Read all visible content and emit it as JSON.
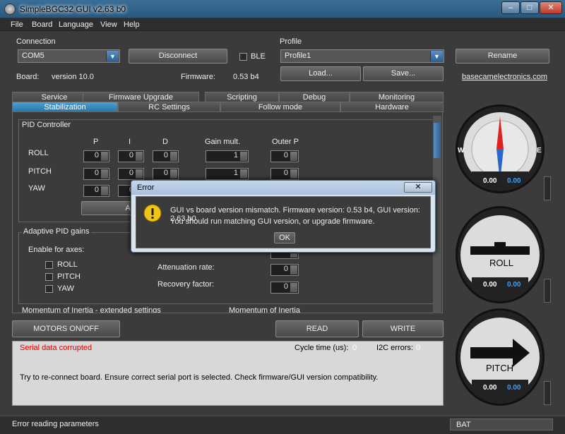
{
  "window": {
    "title": "SimpleBGC32 GUI v2.63 b0",
    "minimize": "‒",
    "maximize": "□",
    "close": "✕"
  },
  "menu": [
    "File",
    "Board",
    "Language",
    "View",
    "Help"
  ],
  "connection": {
    "heading": "Connection",
    "port": "COM5",
    "disconnect_label": "Disconnect",
    "ble_label": "BLE",
    "board_label": "Board:",
    "board_value": "version 10.0",
    "firmware_label": "Firmware:",
    "firmware_value": "0.53 b4"
  },
  "profile": {
    "heading": "Profile",
    "value": "Profile1",
    "rename_label": "Rename",
    "load_label": "Load...",
    "save_label": "Save...",
    "link": "basecamelectronics.com"
  },
  "tabs_row1": [
    "Service",
    "Firmware Upgrade",
    "Scripting",
    "Debug",
    "Monitoring"
  ],
  "tabs_row2": [
    "Stabilization",
    "RC Settings",
    "Follow mode",
    "Hardware"
  ],
  "pid": {
    "heading": "PID Controller",
    "columns": [
      "P",
      "I",
      "D",
      "Gain mult.",
      "Outer P"
    ],
    "rows": [
      {
        "label": "ROLL",
        "values": [
          "0",
          "0",
          "0",
          "1",
          "0"
        ]
      },
      {
        "label": "PITCH",
        "values": [
          "0",
          "0",
          "0",
          "1",
          "0"
        ]
      },
      {
        "label": "YAW",
        "values": [
          "0",
          "0",
          "",
          "",
          ""
        ]
      }
    ],
    "auto_label": "AU"
  },
  "adaptive": {
    "heading": "Adaptive PID gains",
    "enable_label": "Enable for axes:",
    "axes": [
      "ROLL",
      "PITCH",
      "YAW"
    ],
    "attenuation_label": "Attenuation rate:",
    "attenuation_value": "0",
    "recovery_label": "Recovery factor:",
    "recovery_value": "0",
    "extra_value": "0"
  },
  "momentum": {
    "extended_heading": "Momentum of Inertia - extended settings",
    "heading": "Momentum of Inertia"
  },
  "actions": {
    "motors_label": "MOTORS ON/OFF",
    "read_label": "READ",
    "write_label": "WRITE"
  },
  "status": {
    "error_text": "Serial data corrupted",
    "cycle_label": "Cycle time (us):",
    "cycle_value": "0",
    "i2c_label": "I2C errors:",
    "i2c_value": "0",
    "hint": "Try to re-connect board. Ensure correct serial port is selected. Check firmware/GUI version compatibility."
  },
  "statusbar": {
    "left": "Error reading parameters",
    "right": "BAT"
  },
  "dialog": {
    "title": "Error",
    "close": "✕",
    "line1": "GUI vs board version mismatch. Firmware version: 0.53 b4, GUI version: 2.63 b0.",
    "line2": "You should run matching GUI version, or upgrade firmware.",
    "ok_label": "OK"
  },
  "gauges": {
    "compass": {
      "west": "W",
      "east": "E",
      "value_a": "0.00",
      "value_b": "0.00"
    },
    "roll": {
      "label": "ROLL",
      "value_a": "0.00",
      "value_b": "0.00"
    },
    "pitch": {
      "label": "PITCH",
      "value_a": "0.00",
      "value_b": "0.00"
    }
  }
}
